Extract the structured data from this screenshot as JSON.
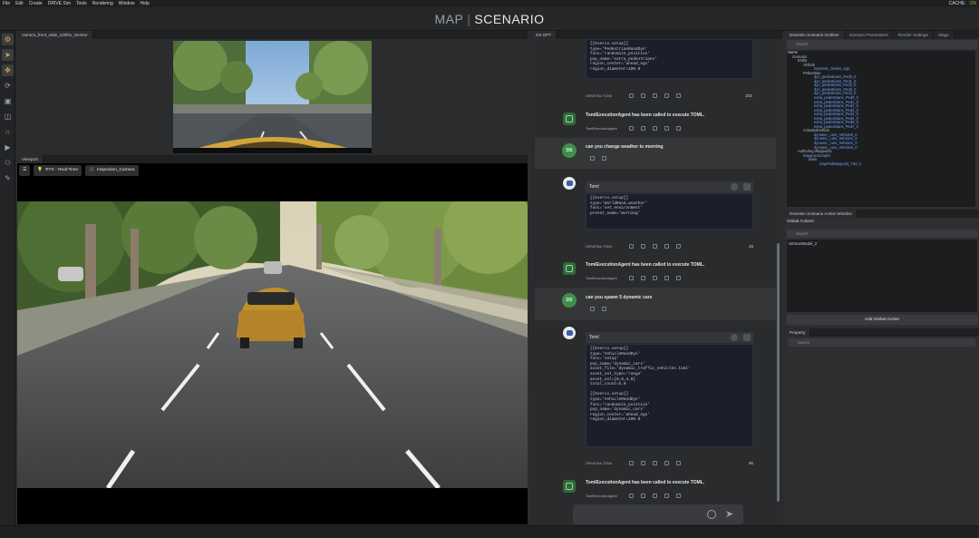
{
  "menu": [
    "File",
    "Edit",
    "Create",
    "DRIVE Sim",
    "Tools",
    "Rendering",
    "Window",
    "Help"
  ],
  "menu_right": {
    "cache": "CACHE:",
    "live": "ON"
  },
  "title": {
    "left": "MAP",
    "sep": "|",
    "right": "SCENARIO"
  },
  "sensor_tab": "camera_front_wide_120fov_Sensor",
  "viewport_tab": "Viewport",
  "viewport_toolbar": {
    "render_mode": "RTX - Real-Time",
    "camera": "Inspection_Camera"
  },
  "chat": {
    "tab": "DS GPT",
    "msg1": {
      "code": "[[Evercs.setup]]\ntype='PedestrianRandDyn'\nfunc='randomize_position'\npop_name='extra_pedestrians'\nregion_center='ahead_ego'\nregion_diameter=100.0",
      "source": "DRIVESim TOML",
      "count": "103"
    },
    "agent_text": "TomlExecutionAgent has been called to execute TOML.",
    "agent_sub": "TomlExecutionAgent",
    "user_avatar": "DS",
    "user1": "can you change weather to morning",
    "toml_label": "Toml",
    "msg2": {
      "code": "[[Evercs.setup]]\ntype='WorldRand.weather'\nfunc='set_environment'\npreset_name='morning'",
      "source": "DRIVESim TOML",
      "count": "26"
    },
    "user2": "can you spawn 5 dynamic cars",
    "msg3": {
      "code": "[[Evercs.setup]]\ntype='VehicleRandDyn'\nfunc='setup'\npop_name='dynamic_cars'\nasset_file='dynamic_traffic_vehicles.toml'\nasset_sel_type='range'\nasset_sel=[0,0,4,0]\ntotal_count=5.0\n\n[[Evercs.setup]]\ntype='VehicleRandDyn'\nfunc='randomize_position'\npop_name='dynamic_cars'\nregion_center='ahead_ego'\nregion_diameter=100.0",
      "source": "DRIVESim TOML",
      "count": "96"
    }
  },
  "outliner": {
    "tabs": [
      "Drivesim Scenario Outliner",
      "Scenario Parameters",
      "Render Settings",
      "Stage"
    ],
    "search": "Search",
    "col": "Name",
    "tree": [
      {
        "t": "Scenario",
        "d": 1,
        "c": "white"
      },
      {
        "t": "Entity",
        "d": 2,
        "c": "white"
      },
      {
        "t": "Vehicle",
        "d": 3,
        "c": "white"
      },
      {
        "t": "Dynamic_Sedan_ego",
        "d": 5,
        "c": "blue"
      },
      {
        "t": "Pedestrian",
        "d": 3,
        "c": "white"
      },
      {
        "t": "dyn_pedestrians_Ped0_0",
        "d": 5,
        "c": "blue"
      },
      {
        "t": "dyn_pedestrians_Ped1_0",
        "d": 5,
        "c": "blue"
      },
      {
        "t": "dyn_pedestrians_Ped2_0",
        "d": 5,
        "c": "blue"
      },
      {
        "t": "dyn_pedestrians_Ped3_0",
        "d": 5,
        "c": "blue"
      },
      {
        "t": "dyn_pedestrians_Ped4_0",
        "d": 5,
        "c": "blue"
      },
      {
        "t": "extra_pedestrians_Ped0_0",
        "d": 5,
        "c": "blue"
      },
      {
        "t": "extra_pedestrians_Ped1_0",
        "d": 5,
        "c": "blue"
      },
      {
        "t": "extra_pedestrians_Ped2_0",
        "d": 5,
        "c": "blue"
      },
      {
        "t": "extra_pedestrians_Ped3_0",
        "d": 5,
        "c": "blue"
      },
      {
        "t": "extra_pedestrians_Ped4_0",
        "d": 5,
        "c": "blue"
      },
      {
        "t": "extra_pedestrians_Ped5_0",
        "d": 5,
        "c": "blue"
      },
      {
        "t": "extra_pedestrians_Ped6_0",
        "d": 5,
        "c": "blue"
      },
      {
        "t": "extra_pedestrians_Ped7_0",
        "d": 5,
        "c": "blue"
      },
      {
        "t": "ActuatedVehicle",
        "d": 3,
        "c": "white"
      },
      {
        "t": "dynamic_cars_Vehicle0_0",
        "d": 5,
        "c": "blue"
      },
      {
        "t": "dynamic_cars_Vehicle1_0",
        "d": 5,
        "c": "blue"
      },
      {
        "t": "dynamic_cars_Vehicle2_0",
        "d": 5,
        "c": "blue"
      },
      {
        "t": "dynamic_cars_Vehicle3_0",
        "d": 5,
        "c": "blue"
      },
      {
        "t": "Authoring Waypoints",
        "d": 2,
        "c": "white"
      },
      {
        "t": "WaypointGraphs",
        "d": 3,
        "c": "blue"
      },
      {
        "t": "main",
        "d": 4,
        "c": "white"
      },
      {
        "t": "mapPedWaypoint_734_0",
        "d": 6,
        "c": "blue"
      }
    ]
  },
  "action_window": {
    "tab": "Drivesim Scenario Action Window",
    "global_title": "Global Actions:",
    "search": "Search",
    "items": [
      "SetSunModel_2"
    ],
    "add_button": "Add Global Action"
  },
  "property": {
    "tab": "Property",
    "search": "Search"
  },
  "colors": {
    "accent": "#3f8f4a",
    "code_bg": "#1c1e2b",
    "tree_blue": "#6fa3ff"
  }
}
